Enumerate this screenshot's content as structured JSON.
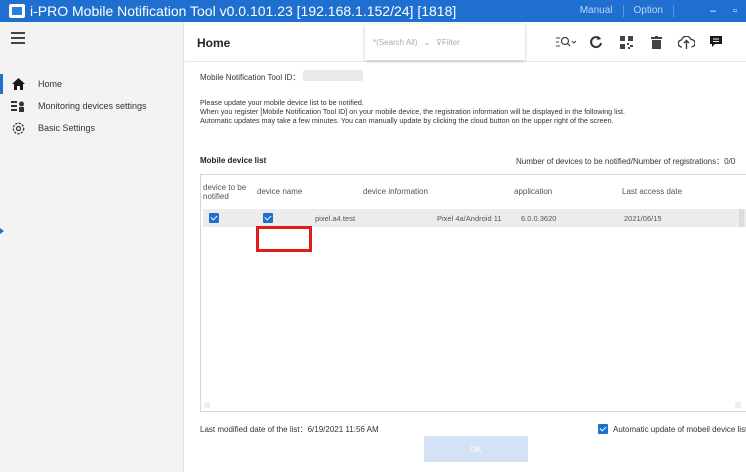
{
  "window": {
    "title": "i-PRO Mobile Notification Tool  v0.0.101.23 [192.168.1.152/24] [1818]",
    "links": [
      "Manual",
      "Option"
    ],
    "minimize": "–",
    "maximize": "▫"
  },
  "sidebar": {
    "items": [
      {
        "label": "Home",
        "icon": "home-icon",
        "active": true
      },
      {
        "label": "Monitoring devices settings",
        "icon": "devices-icon",
        "active": false
      },
      {
        "label": "Basic Settings",
        "icon": "gear-icon",
        "active": false
      }
    ]
  },
  "header": {
    "title": "Home",
    "search_scope": "*(Search All)",
    "filter_placeholder": "Filter"
  },
  "toolbar": {
    "icons": [
      "search-options-icon",
      "refresh-icon",
      "qr-code-icon",
      "delete-icon",
      "cloud-update-icon",
      "message-icon"
    ]
  },
  "main": {
    "tool_id_label": "Mobile Notification Tool ID：",
    "notice_lines": [
      "Please update your mobile device list to be notified.",
      "When you register [Mobile Notification Tool ID] on your mobile device, the registration information will be displayed in the following list.",
      "Automatic updates may take a few minutes. You can manually update by clicking the cloud button on the upper right of the screen."
    ],
    "list_title": "Mobile device list",
    "count_label": "Number of devices to be notified/Number of registrations：0/0",
    "columns": [
      "device to be notified",
      "device name",
      "device information",
      "application",
      "Last access date"
    ],
    "rows": [
      {
        "notified": true,
        "selected": true,
        "device_name": "pixel.a4.test",
        "device_info": "Pixel 4a/Android 11",
        "application": "6.0.0.3620",
        "last_access": "2021/06/15"
      }
    ],
    "modified_label": "Last modified date of the list：6/19/2021 11:56 AM",
    "auto_update_label": "Automatic update of mobeil device list",
    "auto_update_checked": true,
    "ok_label": "OK"
  },
  "colors": {
    "accent": "#1f6fd0",
    "highlight": "#e21a1a",
    "disabled_button": "#d3e3f5"
  }
}
